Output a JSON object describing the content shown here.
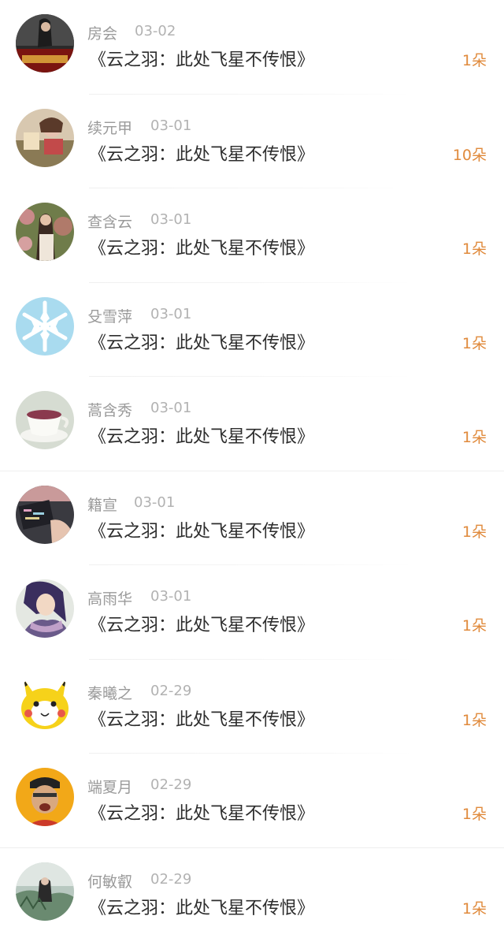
{
  "gift_list": [
    {
      "user": "房会",
      "date": "03-02",
      "work": "《云之羽：此处飞星不传恨》",
      "count": "1朵",
      "avatar": "photo-avatar-icon"
    },
    {
      "user": "续元甲",
      "date": "03-01",
      "work": "《云之羽：此处飞星不传恨》",
      "count": "10朵",
      "avatar": "photo-avatar-icon"
    },
    {
      "user": "查含云",
      "date": "03-01",
      "work": "《云之羽：此处飞星不传恨》",
      "count": "1朵",
      "avatar": "photo-avatar-icon"
    },
    {
      "user": "殳雪萍",
      "date": "03-01",
      "work": "《云之羽：此处飞星不传恨》",
      "count": "1朵",
      "avatar": "snowflake-avatar-icon"
    },
    {
      "user": "蒿含秀",
      "date": "03-01",
      "work": "《云之羽：此处飞星不传恨》",
      "count": "1朵",
      "avatar": "teacup-avatar-icon"
    },
    {
      "user": "籍宣",
      "date": "03-01",
      "work": "《云之羽：此处飞星不传恨》",
      "count": "1朵",
      "avatar": "photo-avatar-icon"
    },
    {
      "user": "高雨华",
      "date": "03-01",
      "work": "《云之羽：此处飞星不传恨》",
      "count": "1朵",
      "avatar": "anime-character-avatar-icon"
    },
    {
      "user": "秦曦之",
      "date": "02-29",
      "work": "《云之羽：此处飞星不传恨》",
      "count": "1朵",
      "avatar": "pikachu-avatar-icon"
    },
    {
      "user": "端夏月",
      "date": "02-29",
      "work": "《云之羽：此处飞星不传恨》",
      "count": "1朵",
      "avatar": "photo-avatar-icon"
    },
    {
      "user": "何敏叡",
      "date": "02-29",
      "work": "《云之羽：此处飞星不传恨》",
      "count": "1朵",
      "avatar": "photo-avatar-icon"
    }
  ],
  "colors": {
    "count": "#e08a3c",
    "name": "#9a9a9a",
    "date": "#b2b2b2",
    "title": "#2d2d2d"
  }
}
